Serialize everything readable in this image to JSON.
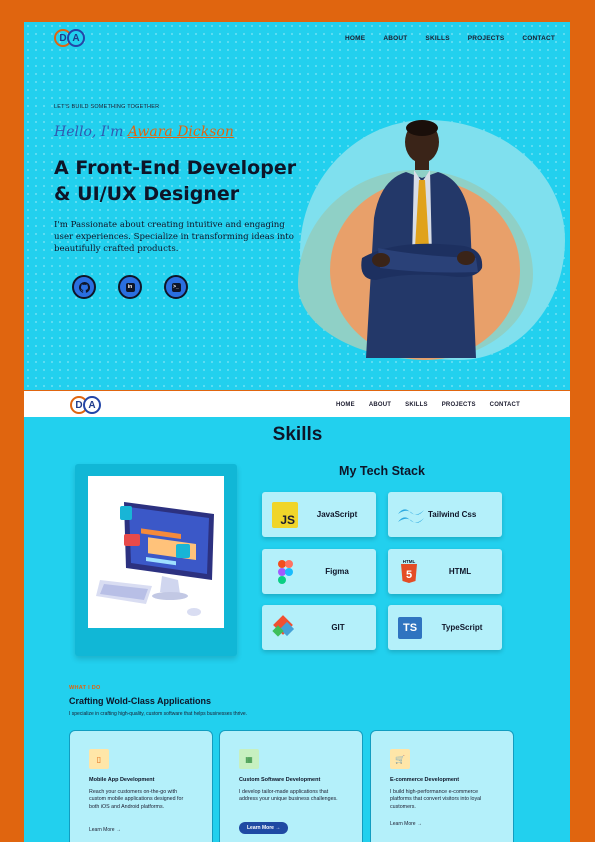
{
  "nav": {
    "items": [
      "HOME",
      "ABOUT",
      "SKILLS",
      "PROJECTS",
      "CONTACT"
    ]
  },
  "logo": {
    "left": "D",
    "right": "A"
  },
  "hero": {
    "tagline": "LET'S BUILD SOMETHING TOGETHER",
    "hello": "Hello, I'm ",
    "name": "Awara Dickson",
    "headline": "A Front-End Developer & UI/UX Designer",
    "intro": "I'm Passionate about creating intuitive and engaging user experiences. Specialize in transforming ideas into beautifully crafted products.",
    "socials": [
      "github-icon",
      "linkedin-icon",
      "terminal-icon"
    ]
  },
  "skills": {
    "title": "Skills",
    "stack_title": "My Tech Stack",
    "techs": [
      {
        "label": "JavaScript",
        "icon": "JS"
      },
      {
        "label": "Tailwind Css",
        "icon": "~"
      },
      {
        "label": "Figma",
        "icon": "F"
      },
      {
        "label": "HTML",
        "icon": "5"
      },
      {
        "label": "GIT",
        "icon": "git"
      },
      {
        "label": "TypeScript",
        "icon": "TS"
      }
    ]
  },
  "services": {
    "eyebrow": "WHAT I DO",
    "title": "Crafting Wold-Class Applications",
    "subtitle": "I specialize in crafting high-quality, custom software that helps businesses thrive.",
    "cards": [
      {
        "title": "Mobile App Development",
        "desc": "Reach your customers on-the-go with custom mobile applications designed for both iOS and Android platforms.",
        "link": "Learn More →"
      },
      {
        "title": "Custom Software Development",
        "desc": "I develop tailor-made applications that address your unique business challenges.",
        "link": "Learn More →"
      },
      {
        "title": "E-commerce Development",
        "desc": "I build high-performance e-commerce platforms that convert visitors into loyal customers.",
        "link": "Learn More →"
      }
    ]
  },
  "colors": {
    "accent": "#e0650f",
    "primary": "#22d0ee",
    "brand_blue": "#1f4aa3"
  }
}
